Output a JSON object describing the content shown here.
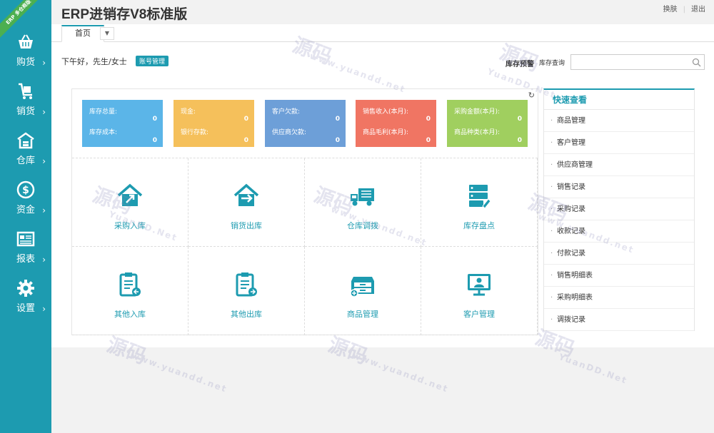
{
  "app": {
    "title": "ERP进销存V8标准版",
    "ribbon": "ERP 多仓商版"
  },
  "top_links": {
    "switch": "换肤",
    "logout": "退出"
  },
  "tabs": {
    "home": "首页"
  },
  "greeting": "下午好，先生/女士",
  "account_button": "账号管理",
  "inventory": {
    "warning": "库存预警",
    "query": "库存查询"
  },
  "search": {
    "placeholder": ""
  },
  "sidebar": {
    "items": [
      {
        "label": "购货",
        "icon": "basket-icon"
      },
      {
        "label": "销货",
        "icon": "cart-icon"
      },
      {
        "label": "仓库",
        "icon": "warehouse-icon"
      },
      {
        "label": "资金",
        "icon": "dollar-icon"
      },
      {
        "label": "报表",
        "icon": "report-icon"
      },
      {
        "label": "设置",
        "icon": "gear-icon"
      }
    ],
    "arrow": "›"
  },
  "cards": [
    {
      "label1": "库存总量:",
      "value1": "0",
      "label2": "库存成本:",
      "value2": "0",
      "color": "#5bb5e8"
    },
    {
      "label1": "现金:",
      "value1": "0",
      "label2": "银行存款:",
      "value2": "0",
      "color": "#f5c05b"
    },
    {
      "label1": "客户欠款:",
      "value1": "0",
      "label2": "供应商欠款:",
      "value2": "0",
      "color": "#6d9fd8"
    },
    {
      "label1": "销售收入(本月):",
      "value1": "0",
      "label2": "商品毛利(本月):",
      "value2": "0",
      "color": "#f07563"
    },
    {
      "label1": "采购金额(本月):",
      "value1": "0",
      "label2": "商品种类(本月):",
      "value2": "0",
      "color": "#a0cf5f"
    }
  ],
  "tiles": [
    {
      "label": "采购入库",
      "icon": "house-in-icon"
    },
    {
      "label": "销货出库",
      "icon": "house-out-icon"
    },
    {
      "label": "仓库调拨",
      "icon": "truck-icon"
    },
    {
      "label": "库存盘点",
      "icon": "stack-edit-icon"
    },
    {
      "label": "其他入库",
      "icon": "clipboard-in-icon"
    },
    {
      "label": "其他出库",
      "icon": "clipboard-out-icon"
    },
    {
      "label": "商品管理",
      "icon": "drawer-plus-icon"
    },
    {
      "label": "客户管理",
      "icon": "monitor-user-icon"
    }
  ],
  "quick": {
    "title": "快速查看",
    "items": [
      "商品管理",
      "客户管理",
      "供应商管理",
      "销售记录",
      "采购记录",
      "收款记录",
      "付款记录",
      "销售明细表",
      "采购明细表",
      "调拨记录"
    ]
  },
  "refresh_icon": "↻",
  "watermark": {
    "main": "源码",
    "url": "www.yuandd.net",
    "sub": "YuanDD.Net"
  },
  "colors": {
    "accent": "#1d9bb0"
  }
}
